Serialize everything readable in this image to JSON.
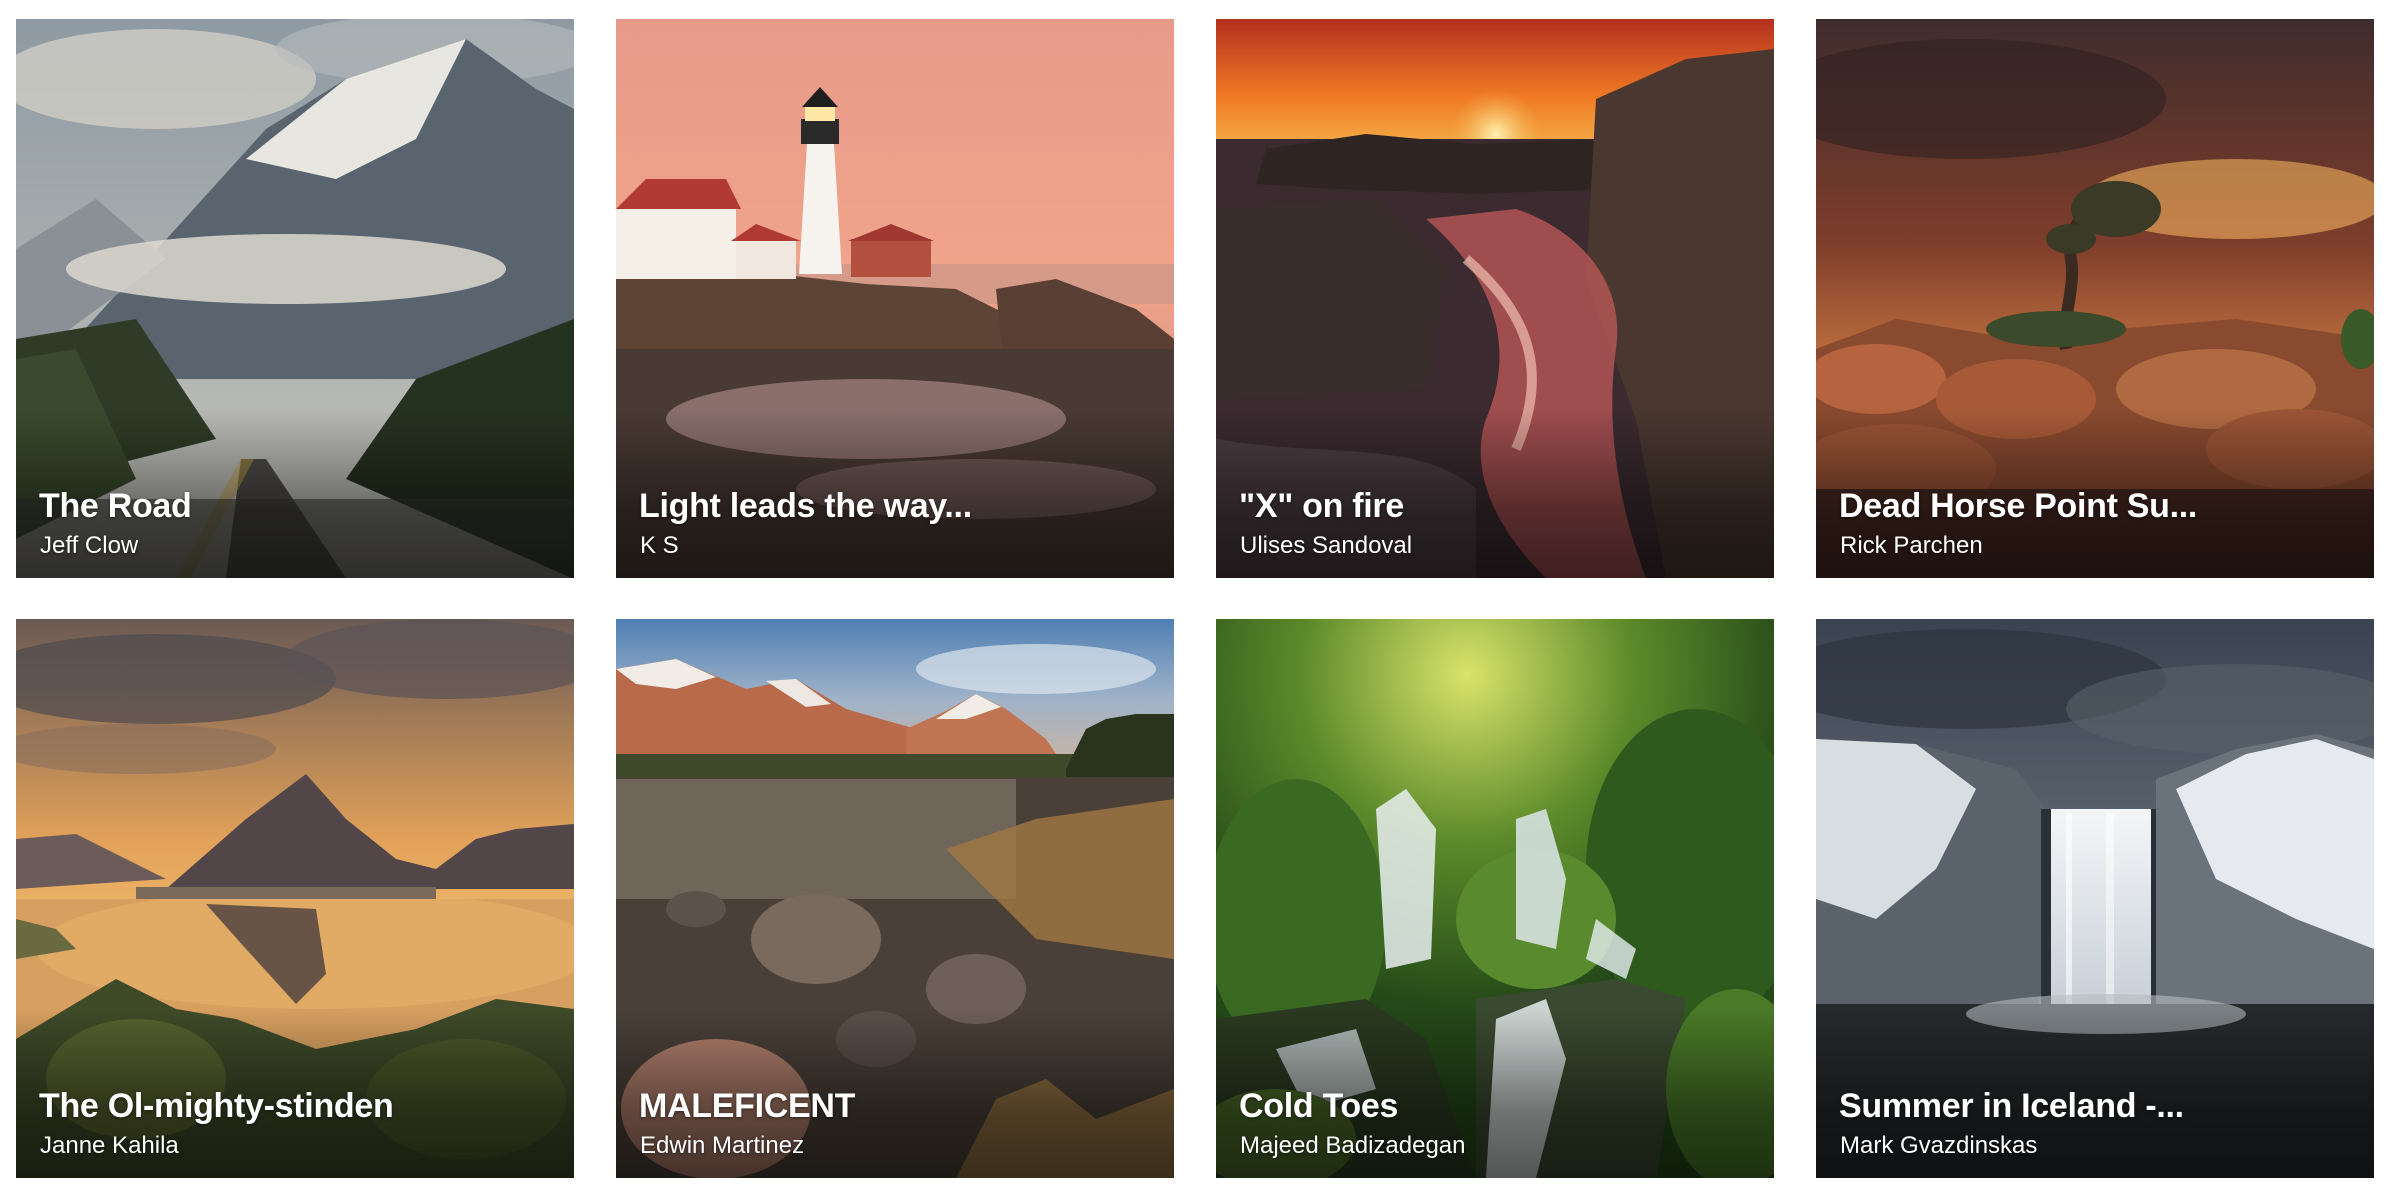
{
  "gallery": {
    "items": [
      {
        "title": "The Road",
        "author": "Jeff Clow"
      },
      {
        "title": "Light leads the way...",
        "author": "K S"
      },
      {
        "title": "\"X\" on fire",
        "author": "Ulises Sandoval"
      },
      {
        "title": "Dead Horse Point Su...",
        "author": "Rick Parchen"
      },
      {
        "title": "The Ol-mighty-stinden",
        "author": "Janne Kahila"
      },
      {
        "title": "MALEFICENT",
        "author": "Edwin Martinez"
      },
      {
        "title": "Cold Toes",
        "author": "Majeed Badizadegan"
      },
      {
        "title": "Summer in Iceland -...",
        "author": "Mark Gvazdinskas"
      }
    ]
  }
}
